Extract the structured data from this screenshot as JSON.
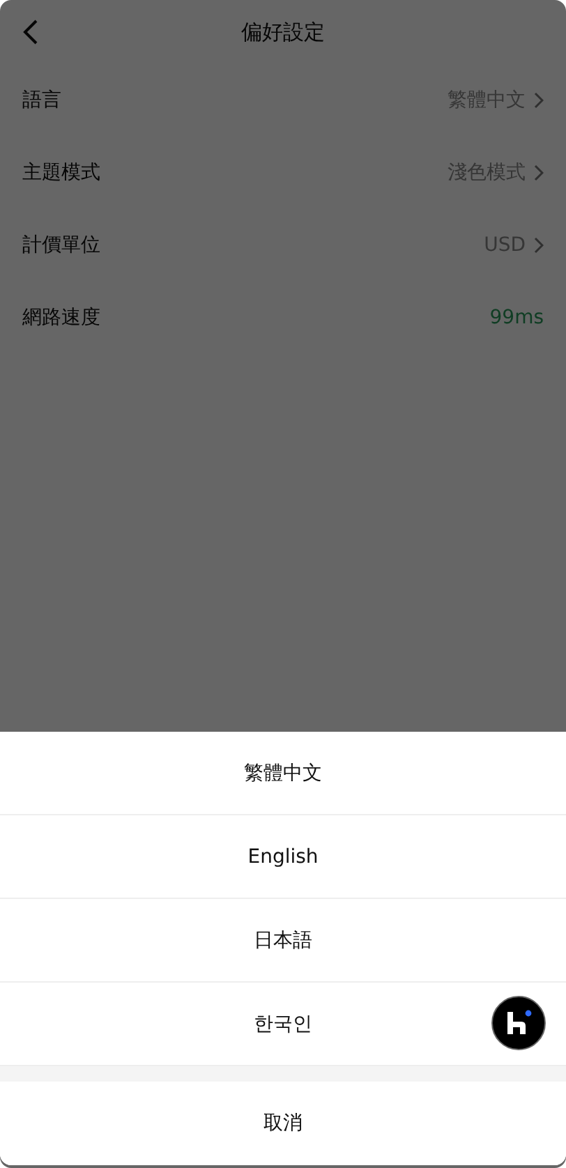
{
  "header": {
    "title": "偏好設定"
  },
  "settings": [
    {
      "label": "語言",
      "value": "繁體中文",
      "kind": "select"
    },
    {
      "label": "主題模式",
      "value": "淺色模式",
      "kind": "select"
    },
    {
      "label": "計價單位",
      "value": "USD",
      "kind": "select"
    },
    {
      "label": "網路速度",
      "value": "99ms",
      "kind": "latency"
    }
  ],
  "action_sheet": {
    "options": [
      "繁體中文",
      "English",
      "日本語",
      "한국인"
    ],
    "cancel": "取消"
  }
}
